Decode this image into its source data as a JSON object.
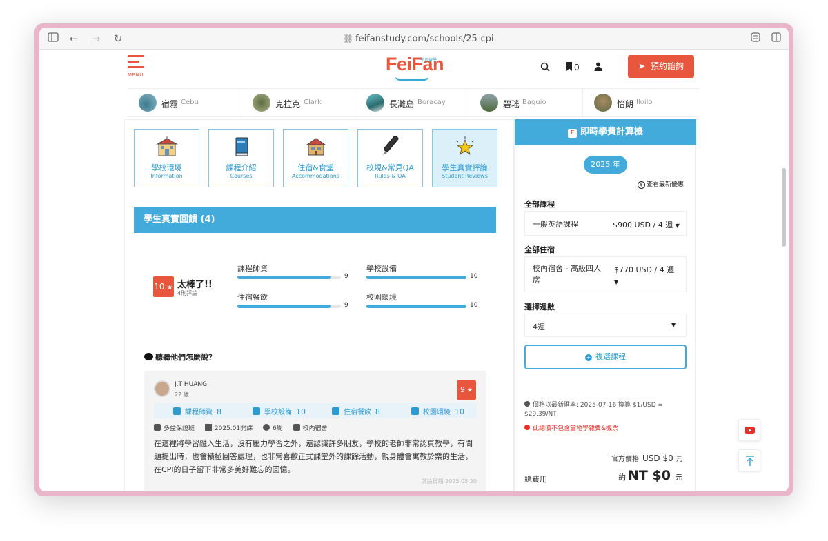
{
  "browser": {
    "url": "feifanstudy.com/schools/25-cpi"
  },
  "header": {
    "menu_label": "MENU",
    "logo_text": "FeiFan",
    "logo_sub": "菲凡留學",
    "bookmark_count": "0",
    "cta_label": "預約諮詢"
  },
  "cities": [
    {
      "zh": "宿霧",
      "en": "Cebu"
    },
    {
      "zh": "克拉克",
      "en": "Clark"
    },
    {
      "zh": "長灘島",
      "en": "Boracay"
    },
    {
      "zh": "碧瑤",
      "en": "Baguio"
    },
    {
      "zh": "怡朗",
      "en": "Iloilo"
    }
  ],
  "tiles": [
    {
      "zh": "學校環境",
      "en": "Information",
      "icon": "school-building-icon"
    },
    {
      "zh": "課程介紹",
      "en": "Courses",
      "icon": "book-icon"
    },
    {
      "zh": "住宿&食堂",
      "en": "Accommodations",
      "icon": "house-icon"
    },
    {
      "zh": "校規&常見QA",
      "en": "Rules & QA",
      "icon": "pen-icon"
    },
    {
      "zh": "學生真實評論",
      "en": "Student Reviews",
      "icon": "star-icon"
    }
  ],
  "reviews_section": {
    "title": "學生真實回饋 (4)",
    "overall_score": "10",
    "overall_label": "太棒了!!",
    "review_count": "4則評論",
    "ratings": [
      {
        "label": "課程師資",
        "value": 9
      },
      {
        "label": "學校設備",
        "value": 10
      },
      {
        "label": "住宿餐飲",
        "value": 9
      },
      {
        "label": "校園環境",
        "value": 10
      }
    ],
    "rating_max": 10,
    "talk_heading": "聽聽他們怎麼說？"
  },
  "review": {
    "name": "J.T HUANG",
    "age": "22 歲",
    "score": "9",
    "ratings": [
      {
        "label": "課程師資",
        "value": "8"
      },
      {
        "label": "學校設備",
        "value": "10"
      },
      {
        "label": "住宿餐飲",
        "value": "8"
      },
      {
        "label": "校園環境",
        "value": "10"
      }
    ],
    "meta": {
      "course": "多益保證班",
      "start": "2025.01開課",
      "weeks": "6周",
      "room": "校內宿舍"
    },
    "text": "在這裡將學習融入生活，沒有壓力學習之外，還認識許多朋友，學校的老師非常認真教學，有問題提出時，也會積極回答處理，也非常喜歡正式課堂外的課餘活動，親身體會寓教於樂的生活，在CPI的日子留下非常多美好難忘的回憶。",
    "date": "評論日期 2025.05.20"
  },
  "calculator": {
    "title": "即時學費計算機",
    "year": "2025 年",
    "promo_link": "查看最新優惠",
    "course_label": "全部課程",
    "course_name": "一般英語課程",
    "course_price": "$900 USD / 4 週",
    "room_label": "全部住宿",
    "room_name": "校內宿舍 - 高級四人房",
    "room_price": "$770 USD / 4 週",
    "weeks_label": "選擇週數",
    "weeks_value": "4週",
    "multi_label": "複選課程",
    "rate_note": "價格以最新匯率: 2025-07-16 換算 $1/USD = $29.39/NT",
    "warning": "此總價不包含當地學雜費&機票",
    "official_label": "官方價格",
    "official_value": "USD $0",
    "official_unit": "元",
    "total_label": "總費用",
    "total_prefix": "約",
    "total_value": "NT  $0",
    "total_unit": "元"
  },
  "colors": {
    "brand_red": "#e8563e",
    "brand_blue": "#42abdc"
  }
}
